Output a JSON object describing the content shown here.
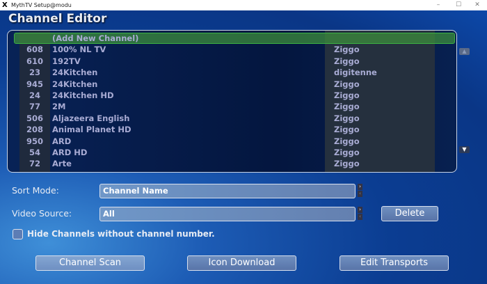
{
  "window": {
    "title": "MythTV Setup@modu",
    "minimize": "–",
    "maximize": "☐",
    "close": "✕"
  },
  "page_title": "Channel Editor",
  "list": {
    "rows": [
      {
        "num": "",
        "name": "(Add New Channel)",
        "source": ""
      },
      {
        "num": "608",
        "name": "100% NL TV",
        "source": "Ziggo"
      },
      {
        "num": "610",
        "name": "192TV",
        "source": "Ziggo"
      },
      {
        "num": "23",
        "name": "24Kitchen",
        "source": "digitenne"
      },
      {
        "num": "945",
        "name": "24Kitchen",
        "source": "Ziggo"
      },
      {
        "num": "24",
        "name": "24Kitchen HD",
        "source": "Ziggo"
      },
      {
        "num": "77",
        "name": "2M",
        "source": "Ziggo"
      },
      {
        "num": "506",
        "name": "Aljazeera English",
        "source": "Ziggo"
      },
      {
        "num": "208",
        "name": "Animal Planet HD",
        "source": "Ziggo"
      },
      {
        "num": "950",
        "name": "ARD",
        "source": "Ziggo"
      },
      {
        "num": "54",
        "name": "ARD HD",
        "source": "Ziggo"
      },
      {
        "num": "72",
        "name": "Arte",
        "source": "Ziggo"
      }
    ],
    "selected_index": 0
  },
  "sort_mode": {
    "label": "Sort Mode:",
    "value": "Channel Name"
  },
  "video_source": {
    "label": "Video Source:",
    "value": "All"
  },
  "delete_label": "Delete",
  "hide_channels": {
    "label": "Hide Channels without channel number.",
    "checked": false
  },
  "buttons": {
    "channel_scan": "Channel Scan",
    "icon_download": "Icon Download",
    "edit_transports": "Edit Transports"
  }
}
